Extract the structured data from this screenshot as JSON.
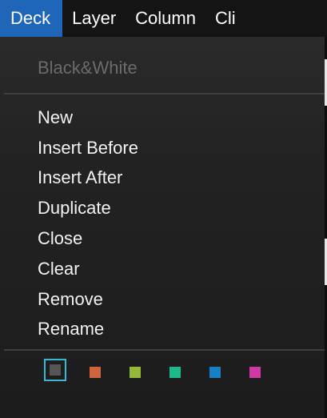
{
  "menubar": {
    "items": [
      {
        "label": "Deck",
        "active": true
      },
      {
        "label": "Layer",
        "active": false
      },
      {
        "label": "Column",
        "active": false
      },
      {
        "label": "Cli",
        "active": false
      }
    ]
  },
  "dropdown": {
    "header": "Black&White",
    "items": [
      {
        "label": "New"
      },
      {
        "label": "Insert Before"
      },
      {
        "label": "Insert After"
      },
      {
        "label": "Duplicate"
      },
      {
        "label": "Close"
      },
      {
        "label": "Clear"
      },
      {
        "label": "Remove"
      },
      {
        "label": "Rename"
      }
    ],
    "colors": [
      {
        "name": "gray",
        "hex": "#555555",
        "selected": true
      },
      {
        "name": "orange",
        "hex": "#d0643f",
        "selected": false
      },
      {
        "name": "green",
        "hex": "#94b93a",
        "selected": false
      },
      {
        "name": "teal",
        "hex": "#1fb88a",
        "selected": false
      },
      {
        "name": "blue",
        "hex": "#1a7fc2",
        "selected": false
      },
      {
        "name": "magenta",
        "hex": "#cf3aa0",
        "selected": false
      }
    ]
  },
  "theme": {
    "accent": "#2066b8",
    "selection_border": "#35b9d6"
  }
}
